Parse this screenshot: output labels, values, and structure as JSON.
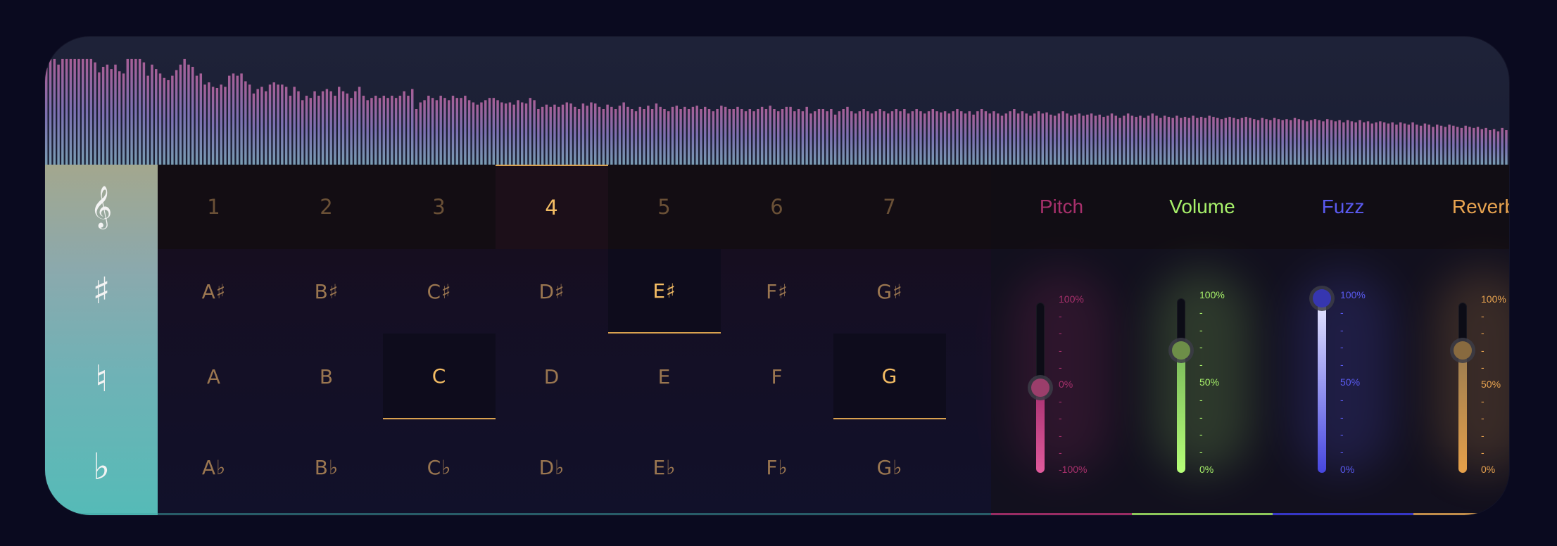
{
  "waveform": {
    "bars": [
      0.87,
      0.95,
      0.95,
      0.9,
      0.95,
      0.95,
      0.95,
      0.95,
      0.95,
      0.95,
      0.95,
      0.95,
      0.92,
      0.83,
      0.88,
      0.9,
      0.86,
      0.9,
      0.84,
      0.82,
      0.95,
      0.95,
      0.95,
      0.95,
      0.92,
      0.8,
      0.9,
      0.86,
      0.82,
      0.78,
      0.76,
      0.8,
      0.85,
      0.9,
      0.95,
      0.9,
      0.88,
      0.8,
      0.82,
      0.72,
      0.74,
      0.7,
      0.69,
      0.72,
      0.7,
      0.8,
      0.82,
      0.8,
      0.82,
      0.75,
      0.72,
      0.64,
      0.68,
      0.7,
      0.66,
      0.72,
      0.74,
      0.72,
      0.72,
      0.7,
      0.62,
      0.7,
      0.66,
      0.58,
      0.62,
      0.6,
      0.66,
      0.62,
      0.66,
      0.68,
      0.66,
      0.62,
      0.7,
      0.66,
      0.64,
      0.6,
      0.66,
      0.7,
      0.62,
      0.58,
      0.6,
      0.62,
      0.6,
      0.62,
      0.6,
      0.62,
      0.6,
      0.62,
      0.66,
      0.62,
      0.68,
      0.5,
      0.56,
      0.58,
      0.62,
      0.6,
      0.58,
      0.62,
      0.6,
      0.58,
      0.62,
      0.6,
      0.6,
      0.62,
      0.58,
      0.56,
      0.54,
      0.56,
      0.58,
      0.6,
      0.6,
      0.58,
      0.56,
      0.55,
      0.56,
      0.54,
      0.58,
      0.56,
      0.55,
      0.6,
      0.58,
      0.5,
      0.52,
      0.54,
      0.52,
      0.54,
      0.52,
      0.54,
      0.56,
      0.55,
      0.52,
      0.5,
      0.55,
      0.53,
      0.56,
      0.55,
      0.52,
      0.5,
      0.54,
      0.52,
      0.5,
      0.53,
      0.56,
      0.52,
      0.5,
      0.48,
      0.52,
      0.5,
      0.53,
      0.5,
      0.55,
      0.52,
      0.5,
      0.48,
      0.52,
      0.53,
      0.5,
      0.52,
      0.5,
      0.52,
      0.53,
      0.5,
      0.52,
      0.5,
      0.48,
      0.5,
      0.53,
      0.52,
      0.5,
      0.5,
      0.52,
      0.5,
      0.48,
      0.5,
      0.48,
      0.5,
      0.52,
      0.5,
      0.53,
      0.5,
      0.48,
      0.5,
      0.52,
      0.52,
      0.48,
      0.5,
      0.48,
      0.52,
      0.46,
      0.48,
      0.5,
      0.5,
      0.48,
      0.5,
      0.45,
      0.48,
      0.5,
      0.52,
      0.48,
      0.46,
      0.48,
      0.5,
      0.48,
      0.46,
      0.48,
      0.5,
      0.48,
      0.46,
      0.48,
      0.5,
      0.48,
      0.5,
      0.46,
      0.48,
      0.5,
      0.48,
      0.46,
      0.48,
      0.5,
      0.48,
      0.47,
      0.48,
      0.46,
      0.48,
      0.5,
      0.48,
      0.46,
      0.48,
      0.45,
      0.48,
      0.5,
      0.48,
      0.46,
      0.48,
      0.46,
      0.44,
      0.46,
      0.48,
      0.5,
      0.46,
      0.48,
      0.46,
      0.44,
      0.46,
      0.48,
      0.46,
      0.47,
      0.45,
      0.44,
      0.46,
      0.48,
      0.46,
      0.44,
      0.45,
      0.46,
      0.44,
      0.45,
      0.46,
      0.44,
      0.45,
      0.43,
      0.44,
      0.46,
      0.44,
      0.42,
      0.44,
      0.46,
      0.44,
      0.43,
      0.44,
      0.42,
      0.44,
      0.46,
      0.44,
      0.42,
      0.44,
      0.43,
      0.42,
      0.44,
      0.42,
      0.43,
      0.42,
      0.44,
      0.42,
      0.43,
      0.42,
      0.44,
      0.43,
      0.42,
      0.41,
      0.42,
      0.43,
      0.42,
      0.41,
      0.42,
      0.43,
      0.42,
      0.41,
      0.4,
      0.42,
      0.41,
      0.4,
      0.42,
      0.41,
      0.4,
      0.41,
      0.4,
      0.42,
      0.41,
      0.4,
      0.39,
      0.4,
      0.41,
      0.4,
      0.39,
      0.41,
      0.4,
      0.39,
      0.4,
      0.38,
      0.4,
      0.39,
      0.38,
      0.4,
      0.38,
      0.39,
      0.37,
      0.38,
      0.39,
      0.38,
      0.37,
      0.38,
      0.36,
      0.38,
      0.37,
      0.36,
      0.38,
      0.36,
      0.35,
      0.37,
      0.36,
      0.34,
      0.36,
      0.35,
      0.34,
      0.36,
      0.35,
      0.34,
      0.33,
      0.35,
      0.34,
      0.33,
      0.34,
      0.32,
      0.33,
      0.31,
      0.32,
      0.3,
      0.33,
      0.31
    ],
    "colors": [
      "#c06aa8",
      "#8e7fc7",
      "#8ab2c8"
    ]
  },
  "sidebar": {
    "items": [
      {
        "label": "𝄞",
        "icon": "treble-clef-icon"
      },
      {
        "label": "♯",
        "icon": "sharp-icon"
      },
      {
        "label": "♮",
        "icon": "natural-icon"
      },
      {
        "label": "♭",
        "icon": "flat-icon"
      }
    ]
  },
  "degrees": {
    "labels": [
      "1",
      "2",
      "3",
      "4",
      "5",
      "6",
      "7"
    ],
    "active_index": 3
  },
  "notes": {
    "sharps": [
      "A♯",
      "B♯",
      "C♯",
      "D♯",
      "E♯",
      "F♯",
      "G♯"
    ],
    "naturals": [
      "A",
      "B",
      "C",
      "D",
      "E",
      "F",
      "G"
    ],
    "flats": [
      "A♭",
      "B♭",
      "C♭",
      "D♭",
      "E♭",
      "F♭",
      "G♭"
    ],
    "active_sharps": [
      4
    ],
    "active_naturals": [
      2,
      6
    ]
  },
  "effects": [
    {
      "name": "Pitch",
      "color": "#a8306c",
      "fill_top": "#a83070",
      "fill_bottom": "#e05a9c",
      "knob": "#9b3e6b",
      "value": 0,
      "range": [
        -100,
        100
      ],
      "ticks": [
        "100%",
        "-",
        "-",
        "-",
        "-",
        "0%",
        "-",
        "-",
        "-",
        "-",
        "-100%"
      ]
    },
    {
      "name": "Volume",
      "color": "#a7f06a",
      "fill_top": "#7ab85a",
      "fill_bottom": "#b6ff78",
      "knob": "#6d8e48",
      "value": 0.7,
      "range": [
        0,
        1
      ],
      "ticks": [
        "100%",
        "-",
        "-",
        "-",
        "-",
        "50%",
        "-",
        "-",
        "-",
        "-",
        "0%"
      ]
    },
    {
      "name": "Fuzz",
      "color": "#5a5af0",
      "fill_top": "#e8e8ff",
      "fill_bottom": "#4646e0",
      "knob": "#3636b0",
      "value": 1.0,
      "range": [
        0,
        1
      ],
      "ticks": [
        "100%",
        "-",
        "-",
        "-",
        "-",
        "50%",
        "-",
        "-",
        "-",
        "-",
        "0%"
      ]
    },
    {
      "name": "Reverb",
      "color": "#e9a450",
      "fill_top": "#9a7c50",
      "fill_bottom": "#e6a04a",
      "knob": "#886a3f",
      "value": 0.72,
      "range": [
        0,
        1
      ],
      "ticks": [
        "100%",
        "-",
        "-",
        "-",
        "-",
        "50%",
        "-",
        "-",
        "-",
        "-",
        "0%"
      ]
    }
  ]
}
